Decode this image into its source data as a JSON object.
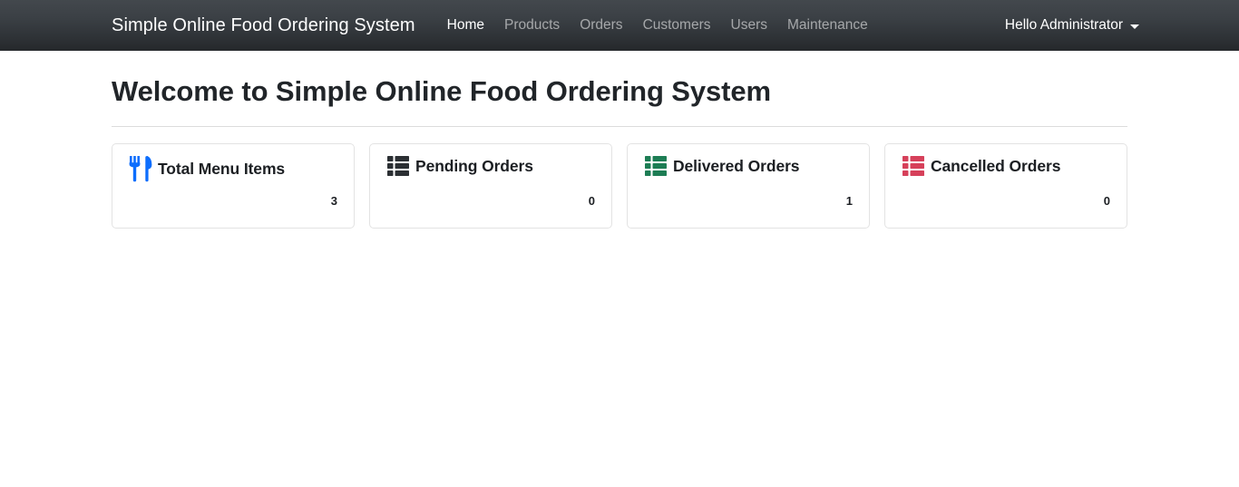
{
  "navbar": {
    "brand": "Simple Online Food Ordering System",
    "links": [
      {
        "label": "Home",
        "active": true
      },
      {
        "label": "Products",
        "active": false
      },
      {
        "label": "Orders",
        "active": false
      },
      {
        "label": "Customers",
        "active": false
      },
      {
        "label": "Users",
        "active": false
      },
      {
        "label": "Maintenance",
        "active": false
      }
    ],
    "user": "Hello Administrator"
  },
  "main": {
    "title": "Welcome to Simple Online Food Ordering System"
  },
  "cards": [
    {
      "label": "Total Menu Items",
      "count": "3",
      "icon": "utensils-icon",
      "color": "#0d6efd"
    },
    {
      "label": "Pending Orders",
      "count": "0",
      "icon": "th-list-icon",
      "color": "#2b2f33"
    },
    {
      "label": "Delivered Orders",
      "count": "1",
      "icon": "th-list-icon",
      "color": "#1d7d54"
    },
    {
      "label": "Cancelled Orders",
      "count": "0",
      "icon": "th-list-icon",
      "color": "#d6405a"
    }
  ]
}
